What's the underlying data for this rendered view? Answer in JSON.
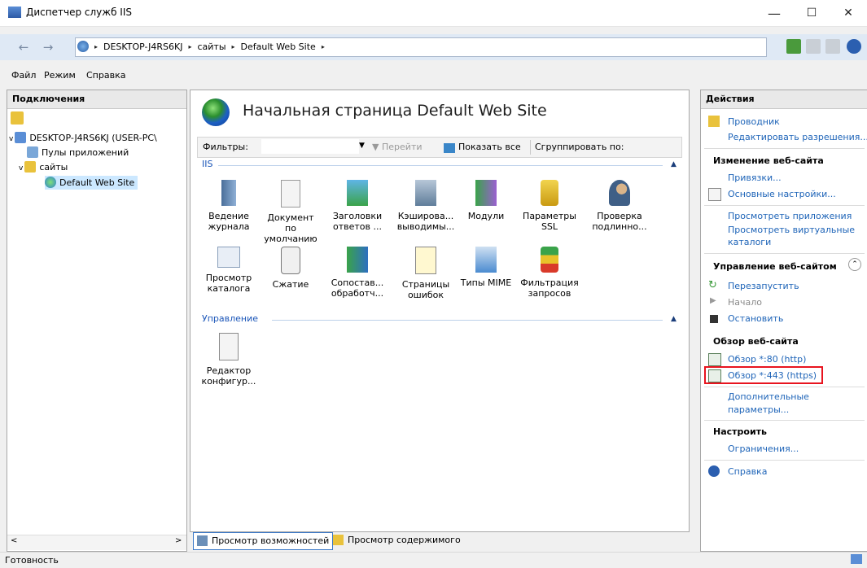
{
  "window": {
    "title": "Диспетчер служб IIS",
    "minimize": "—",
    "maximize": "☐",
    "close": "✕"
  },
  "address": {
    "crumbs": [
      "DESKTOP-J4RS6KJ",
      "сайты",
      "Default Web Site"
    ],
    "sep": "▸"
  },
  "menu": [
    "Файл",
    "Режим",
    "Справка"
  ],
  "connections": {
    "title": "Подключения",
    "tree": [
      {
        "label": "DESKTOP-J4RS6KJ (USER-PC\\",
        "expander": "v"
      },
      {
        "label": "Пулы приложений"
      },
      {
        "label": "сайты",
        "expander": "v"
      },
      {
        "label": "Default Web Site"
      }
    ]
  },
  "content": {
    "title": "Начальная страница Default Web Site",
    "filter": {
      "label": "Фильтры:",
      "go": "Перейти",
      "showall": "Показать все",
      "groupby": "Сгруппировать по:"
    },
    "sections": [
      {
        "name": "IIS"
      },
      {
        "name": "Управление"
      }
    ],
    "features": [
      [
        "Ведение",
        "журнала"
      ],
      [
        "Документ по",
        "умолчанию"
      ],
      [
        "Заголовки",
        "ответов ..."
      ],
      [
        "Кэширова...",
        "выводимы..."
      ],
      [
        "Модули",
        ""
      ],
      [
        "Параметры",
        "SSL"
      ],
      [
        "Проверка",
        "подлинно..."
      ],
      [
        "Просмотр",
        "каталога"
      ],
      [
        "Сжатие",
        ""
      ],
      [
        "Сопостав...",
        "обработч..."
      ],
      [
        "Страницы",
        "ошибок"
      ],
      [
        "Типы MIME",
        ""
      ],
      [
        "Фильтрация",
        "запросов"
      ],
      [
        "Редактор",
        "конфигур..."
      ]
    ],
    "tabs": [
      "Просмотр возможностей",
      "Просмотр содержимого"
    ]
  },
  "actions": {
    "title": "Действия",
    "explorer": "Проводник",
    "edit_perms": "Редактировать разрешения...",
    "edit_site_head": "Изменение веб-сайта",
    "bindings": "Привязки...",
    "basic": "Основные настройки...",
    "view_apps": "Просмотреть приложения",
    "view_vdirs_1": "Просмотреть виртуальные",
    "view_vdirs_2": "каталоги",
    "manage_head": "Управление веб-сайтом",
    "restart": "Перезапустить",
    "start": "Начало",
    "stop": "Остановить",
    "browse_head": "Обзор веб-сайта",
    "browse80": "Обзор *:80 (http)",
    "browse443": "Обзор *:443 (https)",
    "advanced_1": "Дополнительные",
    "advanced_2": "параметры...",
    "configure_head": "Настроить",
    "limits": "Ограничения...",
    "help": "Справка"
  },
  "status": {
    "text": "Готовность"
  },
  "colors": {
    "highlight": "#e8141f",
    "link": "#1e64b8"
  }
}
